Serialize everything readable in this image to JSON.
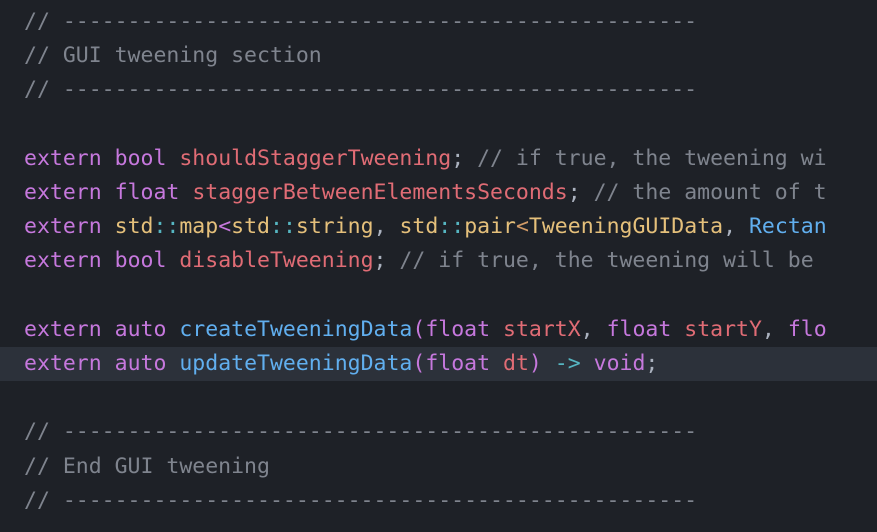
{
  "editor": {
    "lines": [
      {
        "tokens": [
          {
            "t": "// -------------------------------------------------",
            "c": "comment"
          }
        ]
      },
      {
        "tokens": [
          {
            "t": "// GUI tweening section",
            "c": "comment"
          }
        ]
      },
      {
        "tokens": [
          {
            "t": "// -------------------------------------------------",
            "c": "comment"
          }
        ]
      },
      {
        "tokens": []
      },
      {
        "tokens": [
          {
            "t": "extern",
            "c": "kw"
          },
          {
            "t": " ",
            "c": "punc"
          },
          {
            "t": "bool",
            "c": "kw"
          },
          {
            "t": " ",
            "c": "punc"
          },
          {
            "t": "shouldStaggerTweening",
            "c": "var"
          },
          {
            "t": "; ",
            "c": "punc"
          },
          {
            "t": "// if true, the tweening wi",
            "c": "comment"
          }
        ]
      },
      {
        "tokens": [
          {
            "t": "extern",
            "c": "kw"
          },
          {
            "t": " ",
            "c": "punc"
          },
          {
            "t": "float",
            "c": "kw"
          },
          {
            "t": " ",
            "c": "punc"
          },
          {
            "t": "staggerBetweenElementsSeconds",
            "c": "var"
          },
          {
            "t": "; ",
            "c": "punc"
          },
          {
            "t": "// the amount of t",
            "c": "comment"
          }
        ]
      },
      {
        "tokens": [
          {
            "t": "extern",
            "c": "kw"
          },
          {
            "t": " ",
            "c": "punc"
          },
          {
            "t": "std",
            "c": "type"
          },
          {
            "t": "::",
            "c": "op"
          },
          {
            "t": "map",
            "c": "type"
          },
          {
            "t": "<",
            "c": "kw"
          },
          {
            "t": "std",
            "c": "type"
          },
          {
            "t": "::",
            "c": "op"
          },
          {
            "t": "string",
            "c": "type"
          },
          {
            "t": ", ",
            "c": "punc"
          },
          {
            "t": "std",
            "c": "type"
          },
          {
            "t": "::",
            "c": "op"
          },
          {
            "t": "pair",
            "c": "type"
          },
          {
            "t": "<",
            "c": "angle"
          },
          {
            "t": "TweeningGUIData",
            "c": "type"
          },
          {
            "t": ", ",
            "c": "punc"
          },
          {
            "t": "Rectan",
            "c": "fn"
          }
        ]
      },
      {
        "tokens": [
          {
            "t": "extern",
            "c": "kw"
          },
          {
            "t": " ",
            "c": "punc"
          },
          {
            "t": "bool",
            "c": "kw"
          },
          {
            "t": " ",
            "c": "punc"
          },
          {
            "t": "disableTweening",
            "c": "var"
          },
          {
            "t": "; ",
            "c": "punc"
          },
          {
            "t": "// if true, the tweening will be",
            "c": "comment"
          }
        ]
      },
      {
        "tokens": []
      },
      {
        "tokens": [
          {
            "t": "extern",
            "c": "kw"
          },
          {
            "t": " ",
            "c": "punc"
          },
          {
            "t": "auto",
            "c": "kw"
          },
          {
            "t": " ",
            "c": "punc"
          },
          {
            "t": "createTweeningData",
            "c": "fn"
          },
          {
            "t": "(",
            "c": "paren"
          },
          {
            "t": "float",
            "c": "kw"
          },
          {
            "t": " ",
            "c": "punc"
          },
          {
            "t": "startX",
            "c": "var"
          },
          {
            "t": ", ",
            "c": "punc"
          },
          {
            "t": "float",
            "c": "kw"
          },
          {
            "t": " ",
            "c": "punc"
          },
          {
            "t": "startY",
            "c": "var"
          },
          {
            "t": ", ",
            "c": "punc"
          },
          {
            "t": "flo",
            "c": "kw"
          }
        ]
      },
      {
        "active": true,
        "tokens": [
          {
            "t": "extern",
            "c": "kw"
          },
          {
            "t": " ",
            "c": "punc"
          },
          {
            "t": "auto",
            "c": "kw"
          },
          {
            "t": " ",
            "c": "punc"
          },
          {
            "t": "updateTweeningData",
            "c": "fn"
          },
          {
            "t": "(",
            "c": "paren"
          },
          {
            "t": "float",
            "c": "kw"
          },
          {
            "t": " ",
            "c": "punc"
          },
          {
            "t": "dt",
            "c": "var"
          },
          {
            "t": ")",
            "c": "paren"
          },
          {
            "t": " ",
            "c": "punc"
          },
          {
            "t": "->",
            "c": "op"
          },
          {
            "t": " ",
            "c": "punc"
          },
          {
            "t": "void",
            "c": "kw"
          },
          {
            "t": ";",
            "c": "punc"
          }
        ]
      },
      {
        "tokens": []
      },
      {
        "tokens": [
          {
            "t": "// -------------------------------------------------",
            "c": "comment"
          }
        ]
      },
      {
        "tokens": [
          {
            "t": "// End GUI tweening",
            "c": "comment"
          }
        ]
      },
      {
        "tokens": [
          {
            "t": "// -------------------------------------------------",
            "c": "comment"
          }
        ]
      }
    ]
  },
  "colors": {
    "background": "#1e2127",
    "active_line": "#2c313a",
    "comment": "#7f848e",
    "keyword": "#c678dd",
    "type": "#e5c07b",
    "variable": "#e06c75",
    "function": "#61afef",
    "operator": "#56b6c2"
  }
}
